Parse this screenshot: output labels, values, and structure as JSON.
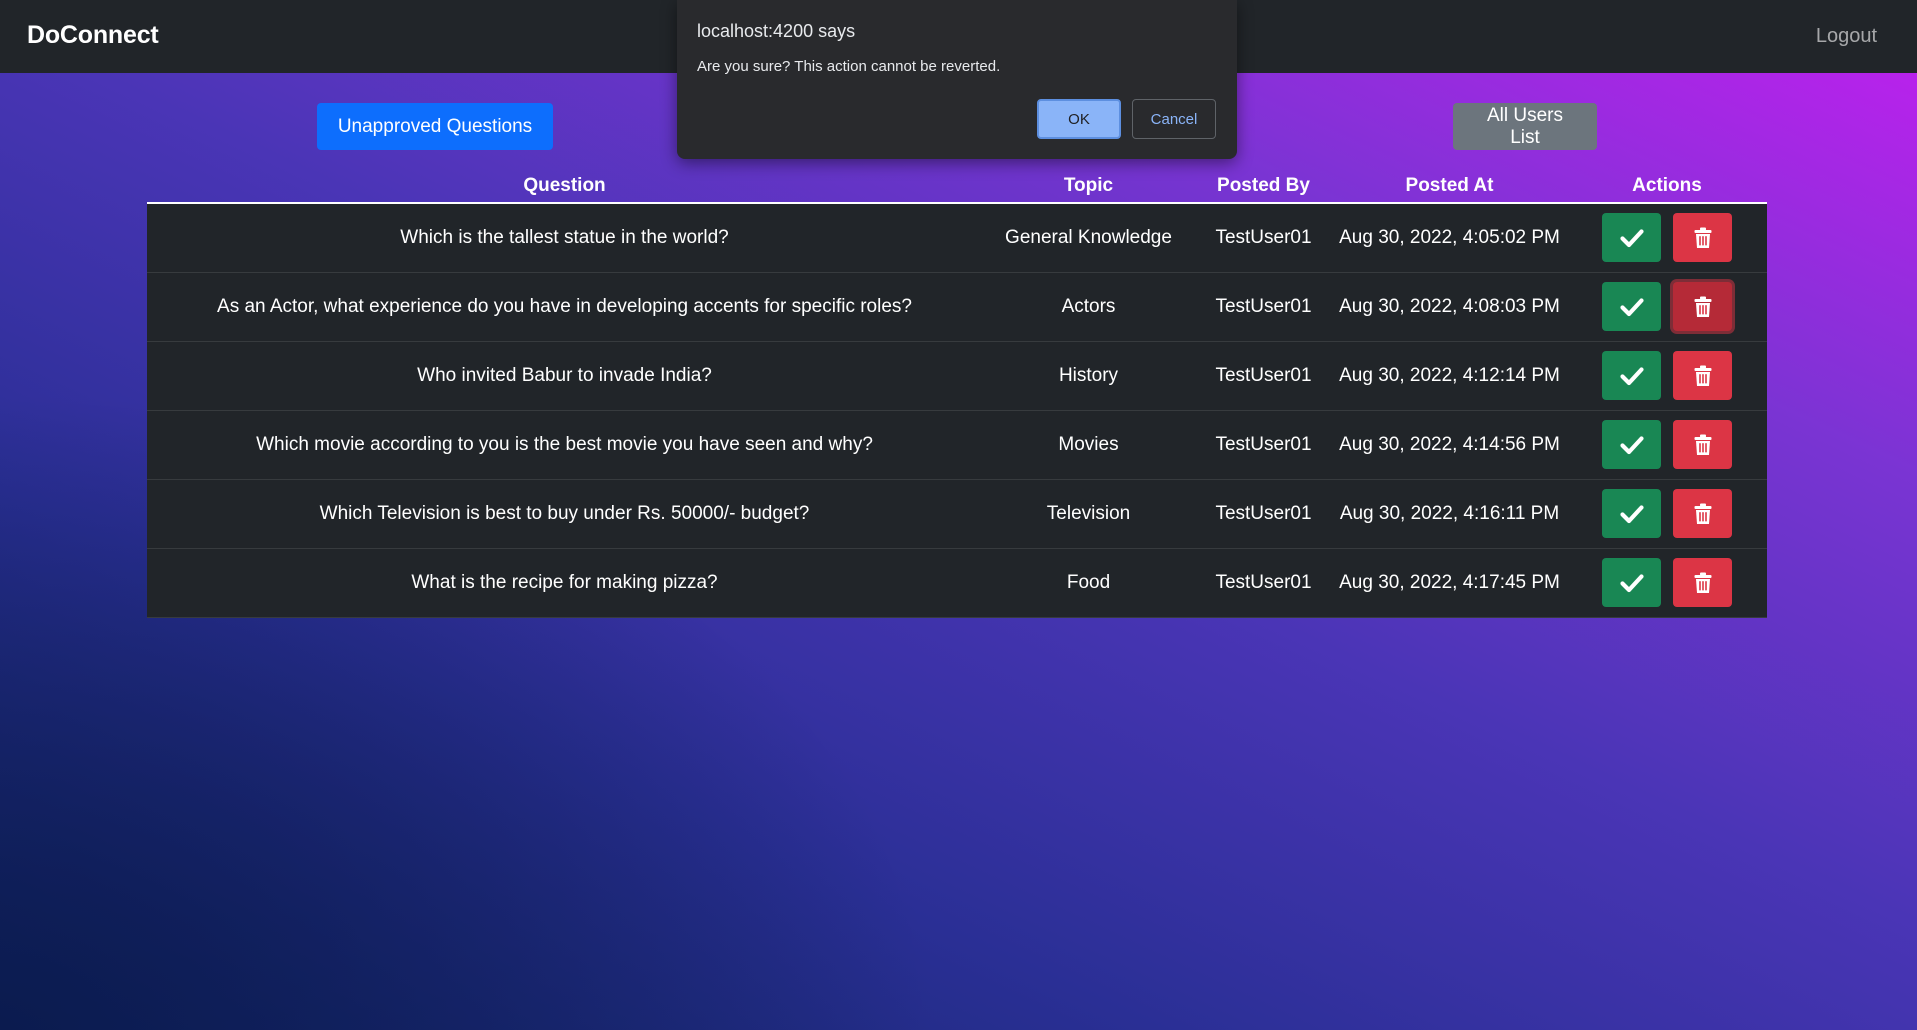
{
  "navbar": {
    "brand": "DoConnect",
    "logout_label": "Logout"
  },
  "buttons": {
    "unapproved": "Unapproved Questions",
    "all_users": "All Users List"
  },
  "table": {
    "headers": [
      "Question",
      "Topic",
      "Posted By",
      "Posted At",
      "Actions"
    ],
    "rows": [
      {
        "question": "Which is the tallest statue in the world?",
        "topic": "General Knowledge",
        "posted_by": "TestUser01",
        "posted_at": "Aug 30, 2022, 4:05:02 PM"
      },
      {
        "question": "As an Actor, what experience do you have in developing accents for specific roles?",
        "topic": "Actors",
        "posted_by": "TestUser01",
        "posted_at": "Aug 30, 2022, 4:08:03 PM"
      },
      {
        "question": "Who invited Babur to invade India?",
        "topic": "History",
        "posted_by": "TestUser01",
        "posted_at": "Aug 30, 2022, 4:12:14 PM"
      },
      {
        "question": "Which movie according to you is the best movie you have seen and why?",
        "topic": "Movies",
        "posted_by": "TestUser01",
        "posted_at": "Aug 30, 2022, 4:14:56 PM"
      },
      {
        "question": "Which Television is best to buy under Rs. 50000/- budget?",
        "topic": "Television",
        "posted_by": "TestUser01",
        "posted_at": "Aug 30, 2022, 4:16:11 PM"
      },
      {
        "question": "What is the recipe for making pizza?",
        "topic": "Food",
        "posted_by": "TestUser01",
        "posted_at": "Aug 30, 2022, 4:17:45 PM"
      }
    ],
    "action_icons": {
      "approve": "check-icon",
      "delete": "trash-icon"
    },
    "focused_delete_row": 1
  },
  "dialog": {
    "title": "localhost:4200 says",
    "message": "Are you sure? This action cannot be reverted.",
    "ok_label": "OK",
    "cancel_label": "Cancel"
  },
  "colors": {
    "navbar": "#212529",
    "primary": "#0d6efd",
    "secondary": "#6c757d",
    "success": "#198754",
    "danger": "#dc3545",
    "dialog_bg": "#292a2d",
    "dialog_accent": "#8ab4f8"
  }
}
